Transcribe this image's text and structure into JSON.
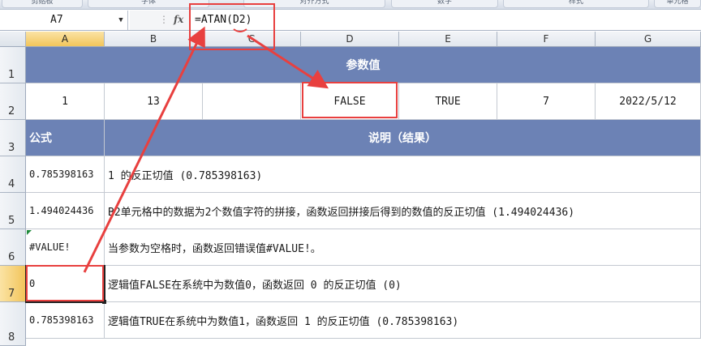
{
  "ribbon": {
    "groups": [
      "剪贴板",
      "字体",
      "对齐方式",
      "数字",
      "样式",
      "单元格"
    ]
  },
  "formula_bar": {
    "name_box": "A7",
    "fx": "fx",
    "formula": "=ATAN(D2)"
  },
  "columns": [
    "A",
    "B",
    "C",
    "D",
    "E",
    "F",
    "G"
  ],
  "rows": [
    "1",
    "2",
    "3",
    "4",
    "5",
    "6",
    "7",
    "8"
  ],
  "sheet": {
    "params_title": "参数值",
    "params": [
      "1",
      "13",
      "",
      "FALSE",
      "TRUE",
      "7",
      "2022/5/12"
    ],
    "formula_header": "公式",
    "desc_header": "说明（结果）",
    "data_rows": [
      {
        "value": "0.785398163",
        "desc": "1 的反正切值 (0.785398163)"
      },
      {
        "value": "1.494024436",
        "desc": "B2单元格中的数据为2个数值字符的拼接，函数返回拼接后得到的数值的反正切值 (1.494024436)"
      },
      {
        "value": "#VALUE!",
        "desc": "当参数为空格时，函数返回错误值#VALUE!。"
      },
      {
        "value": "0",
        "desc": "逻辑值FALSE在系统中为数值0，函数返回 0 的反正切值 (0)"
      },
      {
        "value": "0.785398163",
        "desc": "逻辑值TRUE在系统中为数值1，函数返回 1 的反正切值 (0.785398163)"
      }
    ]
  },
  "colors": {
    "header_band": "#6c82b5",
    "annotation_red": "#e8403f",
    "selected_header": "#f2c55b"
  }
}
